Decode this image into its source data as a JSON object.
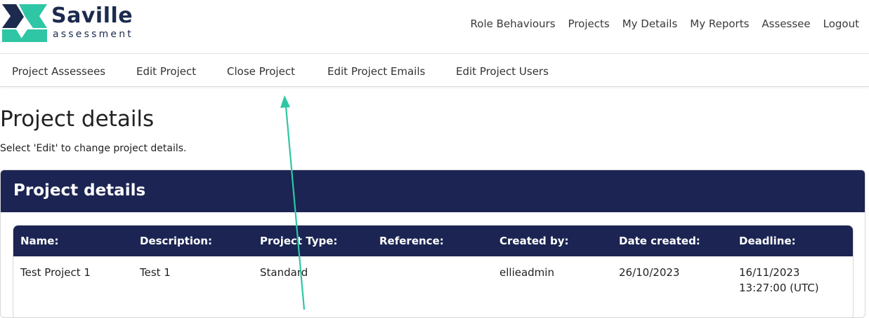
{
  "brand": {
    "name": "Saville",
    "subtitle": "assessment",
    "colors": {
      "navy": "#1c2a4e",
      "teal": "#2fc6a5"
    }
  },
  "topnav": {
    "items": [
      "Role Behaviours",
      "Projects",
      "My Details",
      "My Reports",
      "Assessee",
      "Logout"
    ]
  },
  "subnav": {
    "items": [
      "Project Assessees",
      "Edit Project",
      "Close Project",
      "Edit Project Emails",
      "Edit Project Users"
    ]
  },
  "page": {
    "title": "Project details",
    "subtitle": "Select 'Edit' to change project details."
  },
  "card": {
    "title": "Project details",
    "header_color": "#1b2452"
  },
  "table": {
    "columns": [
      "Name:",
      "Description:",
      "Project Type:",
      "Reference:",
      "Created by:",
      "Date created:",
      "Deadline:"
    ],
    "rows": [
      {
        "name": "Test Project 1",
        "description": "Test 1",
        "project_type": "Standard",
        "reference": "",
        "created_by": "ellieadmin",
        "date_created": "26/10/2023",
        "deadline_date": "16/11/2023",
        "deadline_time": "13:27:00 (UTC)"
      }
    ]
  },
  "annotation": {
    "type": "arrow",
    "color": "#2fc6a5",
    "points_to": "Close Project"
  }
}
